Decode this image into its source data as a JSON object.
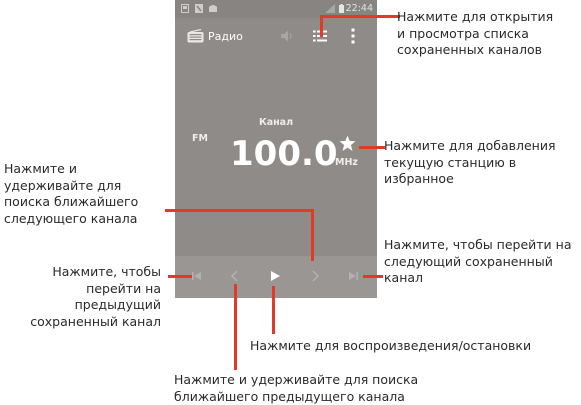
{
  "status_bar": {
    "time": "22:44"
  },
  "app_bar": {
    "title": "Радио"
  },
  "tuner": {
    "channel_label": "Канал",
    "band": "FM",
    "frequency": "100.0",
    "unit": "MHz"
  },
  "icons": {
    "radio": "radio-icon",
    "speaker": "speaker-icon",
    "list": "list-icon",
    "menu": "overflow-menu-icon",
    "star": "star-icon",
    "skip_prev": "skip-previous-icon",
    "seek_prev": "chevron-left-icon",
    "play": "play-icon",
    "seek_next": "chevron-right-icon",
    "skip_next": "skip-next-icon"
  },
  "colors": {
    "accent": "#e23a26",
    "screen": "#8e8b88",
    "controls": "#999693"
  },
  "callouts": {
    "list": [
      "Нажмите для открытия",
      "и просмотра списка",
      "сохраненных каналов"
    ],
    "favorite": [
      "Нажмите для добавления",
      "текущую станцию в",
      "избранное"
    ],
    "seek_next": [
      "Нажмите и",
      "удерживайте для",
      "поиска ближайшего",
      "следующего канала"
    ],
    "skip_next": [
      "Нажмите, чтобы перейти на",
      "следующий сохраненный",
      "канал"
    ],
    "skip_prev": [
      "Нажмите, чтобы",
      "перейти на",
      "предыдущий",
      "сохраненный канал"
    ],
    "play": [
      "Нажмите для воспроизведения/остановки"
    ],
    "seek_prev": [
      "Нажмите и удерживайте для поиска",
      "ближайшего предыдущего канала"
    ]
  }
}
